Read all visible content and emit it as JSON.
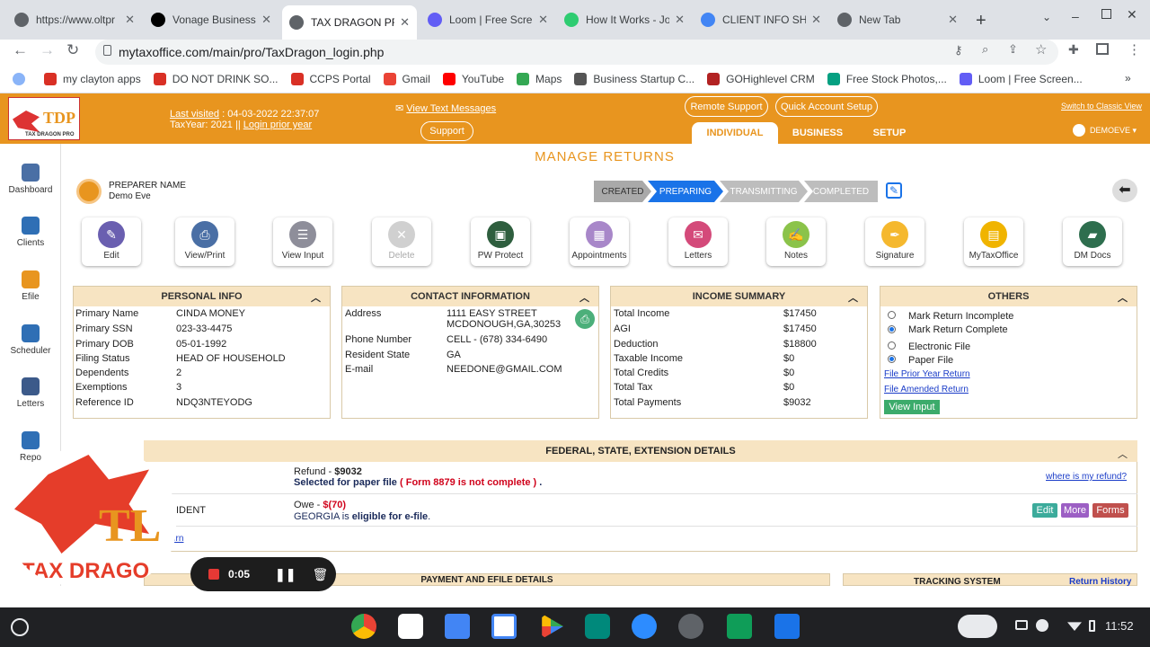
{
  "browser": {
    "tabs": [
      {
        "title": "https://www.oltpr",
        "active": false,
        "color": "#5f6368"
      },
      {
        "title": "Vonage Business",
        "active": false,
        "color": "#000000"
      },
      {
        "title": "TAX DRAGON PRO",
        "active": true,
        "color": "#5f6368"
      },
      {
        "title": "Loom | Free Scree",
        "active": false,
        "color": "#625df5"
      },
      {
        "title": "How It Works - Joi",
        "active": false,
        "color": "#2ecc71"
      },
      {
        "title": "CLIENT INFO SHE",
        "active": false,
        "color": "#4285f4"
      },
      {
        "title": "New Tab",
        "active": false,
        "color": "#5f6368"
      }
    ],
    "url": "mytaxoffice.com/main/pro/TaxDragon_login.php",
    "bookmarks": [
      {
        "label": "my clayton apps",
        "color": "#d93025"
      },
      {
        "label": "DO NOT DRINK SO...",
        "color": "#d93025"
      },
      {
        "label": "CCPS Portal",
        "color": "#d93025"
      },
      {
        "label": "Gmail",
        "color": "#ea4335"
      },
      {
        "label": "YouTube",
        "color": "#ff0000"
      },
      {
        "label": "Maps",
        "color": "#34a853"
      },
      {
        "label": "Business Startup C...",
        "color": "#555555"
      },
      {
        "label": "GOHighlevel CRM",
        "color": "#b22222"
      },
      {
        "label": "Free Stock Photos,...",
        "color": "#05a081"
      },
      {
        "label": "Loom | Free Screen...",
        "color": "#625df5"
      }
    ]
  },
  "header": {
    "last_visited_label": "Last visited",
    "last_visited_value": ": 04-03-2022 22:37:07",
    "taxyear_label": "TaxYear:  2021  ||",
    "login_prior": "Login prior year",
    "view_text": "View Text Messages",
    "support": "Support",
    "remote_support": "Remote Support",
    "quick_setup": "Quick Account Setup",
    "classic_view": "Switch to Classic View",
    "user": "DEMOEVE ▾",
    "nav": [
      "INDIVIDUAL",
      "BUSINESS",
      "SETUP"
    ],
    "logo_text": "TDP",
    "logo_sub": "TAX DRAGON PRO"
  },
  "sidebar": [
    {
      "label": "Dashboard",
      "color": "#4a6fa5"
    },
    {
      "label": "Clients",
      "color": "#2f6fb5"
    },
    {
      "label": "Efile",
      "color": "#e8951f"
    },
    {
      "label": "Scheduler",
      "color": "#2f6fb5"
    },
    {
      "label": "Letters",
      "color": "#3c5a8a"
    },
    {
      "label": "Repo",
      "color": "#2f6fb5"
    }
  ],
  "main": {
    "title": "MANAGE RETURNS",
    "preparer_label": "PREPARER NAME",
    "preparer_value": "Demo Eve",
    "steps": [
      "CREATED",
      "PREPARING",
      "TRANSMITTING",
      "COMPLETED"
    ],
    "actions": [
      {
        "label": "Edit",
        "color": "#6a5fb0",
        "glyph": "✎"
      },
      {
        "label": "View/Print",
        "color": "#4a6fa5",
        "glyph": "⎙"
      },
      {
        "label": "View Input",
        "color": "#8e8e9a",
        "glyph": "☰"
      },
      {
        "label": "Delete",
        "color": "#d0d0d0",
        "glyph": "✕"
      },
      {
        "label": "PW Protect",
        "color": "#2e5e3e",
        "glyph": "▣"
      },
      {
        "label": "Appointments",
        "color": "#a887c9",
        "glyph": "▦"
      },
      {
        "label": "Letters",
        "color": "#d44a7a",
        "glyph": "✉"
      },
      {
        "label": "Notes",
        "color": "#8bc34a",
        "glyph": "✍"
      },
      {
        "label": "Signature",
        "color": "#f5b82e",
        "glyph": "✒"
      },
      {
        "label": "MyTaxOffice",
        "color": "#f0b400",
        "glyph": "▤"
      },
      {
        "label": "DM Docs",
        "color": "#2e6e4e",
        "glyph": "▰"
      }
    ]
  },
  "personal": {
    "title": "PERSONAL INFO",
    "rows": [
      {
        "k": "Primary Name",
        "v": "CINDA MONEY"
      },
      {
        "k": "Primary SSN",
        "v": "023-33-4475"
      },
      {
        "k": "Primary DOB",
        "v": "05-01-1992"
      },
      {
        "k": "Filing Status",
        "v": "HEAD OF HOUSEHOLD"
      },
      {
        "k": "Dependents",
        "v": "2"
      },
      {
        "k": "Exemptions",
        "v": "3"
      },
      {
        "k": "Reference ID",
        "v": "NDQ3NTEYODG"
      }
    ]
  },
  "contact": {
    "title": "CONTACT INFORMATION",
    "address_label": "Address",
    "address1": "1111 EASY STREET",
    "address2": "MCDONOUGH,GA,30253",
    "phone_label": "Phone Number",
    "phone": "CELL - (678) 334-6490",
    "state_label": "Resident State",
    "state": "GA",
    "email_label": "E-mail",
    "email": "NEEDONE@GMAIL.COM"
  },
  "income": {
    "title": "INCOME SUMMARY",
    "rows": [
      {
        "k": "Total Income",
        "v": "$17450"
      },
      {
        "k": "AGI",
        "v": "$17450"
      },
      {
        "k": "Deduction",
        "v": "$18800"
      },
      {
        "k": "Taxable Income",
        "v": "$0"
      },
      {
        "k": "Total Credits",
        "v": "$0"
      },
      {
        "k": "Total Tax",
        "v": "$0"
      },
      {
        "k": "Total Payments",
        "v": "$9032"
      }
    ]
  },
  "others": {
    "title": "OTHERS",
    "r1": "Mark Return Incomplete",
    "r2": "Mark Return Complete",
    "r3": "Electronic File",
    "r4": "Paper File",
    "link1": "File Prior Year Return",
    "link2": "File Amended Return",
    "view_input": "View Input"
  },
  "federal": {
    "title": "FEDERAL, STATE, EXTENSION DETAILS",
    "refund_label": "Refund - ",
    "refund_amt": "$9032",
    "paper_a": "Selected for paper file",
    "paper_b": "( Form 8879 is not complete )",
    "paper_c": ".",
    "refund_link": "where is my refund?",
    "resident": "IDENT",
    "owe_label": "Owe - ",
    "owe_amt": "$(70)",
    "ga_a": "GEORGIA is ",
    "ga_b": "eligible for e-file",
    "ga_c": ".",
    "btn_edit": "Edit",
    "btn_more": "More",
    "btn_forms": "Forms",
    "partial_link": "urn"
  },
  "bottom": {
    "payment": "PAYMENT AND EFILE DETAILS",
    "tracking": "TRACKING SYSTEM",
    "history": "Return History"
  },
  "recorder": {
    "time": "0:05"
  },
  "overlay": {
    "logo_text": "TAX DRAGO",
    "letters": "TL"
  },
  "taskbar": {
    "clock": "11:52"
  }
}
